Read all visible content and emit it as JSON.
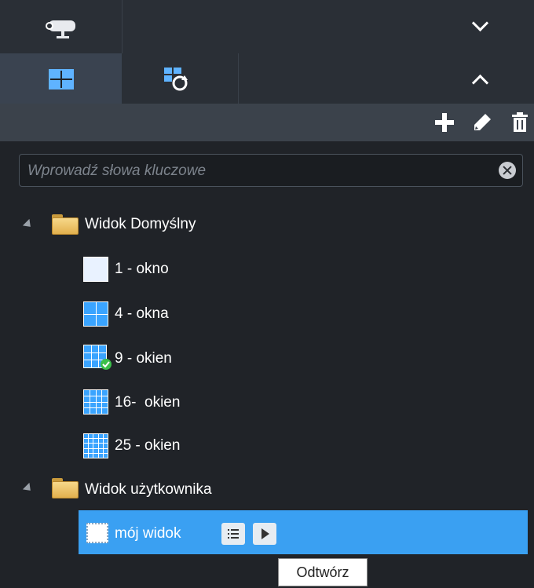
{
  "header": {
    "tabs": [
      {
        "icon": "camera-icon"
      },
      {
        "icon": "view-grid-icon"
      },
      {
        "icon": "sequence-refresh-icon"
      }
    ],
    "collapse_icon": "chevron-down-icon",
    "expand_icon": "chevron-up-icon"
  },
  "toolbar": {
    "add_icon": "plus-icon",
    "edit_icon": "pencil-icon",
    "delete_icon": "trash-icon"
  },
  "search": {
    "placeholder": "Wprowadź słowa kluczowe",
    "value": ""
  },
  "tree": {
    "default_group": {
      "label": "Widok Domyślny",
      "items": [
        {
          "label": "1 - okno"
        },
        {
          "label": "4 - okna"
        },
        {
          "label": "9 - okien"
        },
        {
          "label": "16-  okien"
        },
        {
          "label": "25 - okien"
        }
      ]
    },
    "user_group": {
      "label": "Widok użytkownika",
      "items": [
        {
          "label": "mój widok"
        }
      ]
    }
  },
  "tooltip": {
    "text": "Odtwórz"
  },
  "colors": {
    "selection": "#3aa0f2",
    "panel": "#202328",
    "accent_grid": "#3aa4ff"
  }
}
